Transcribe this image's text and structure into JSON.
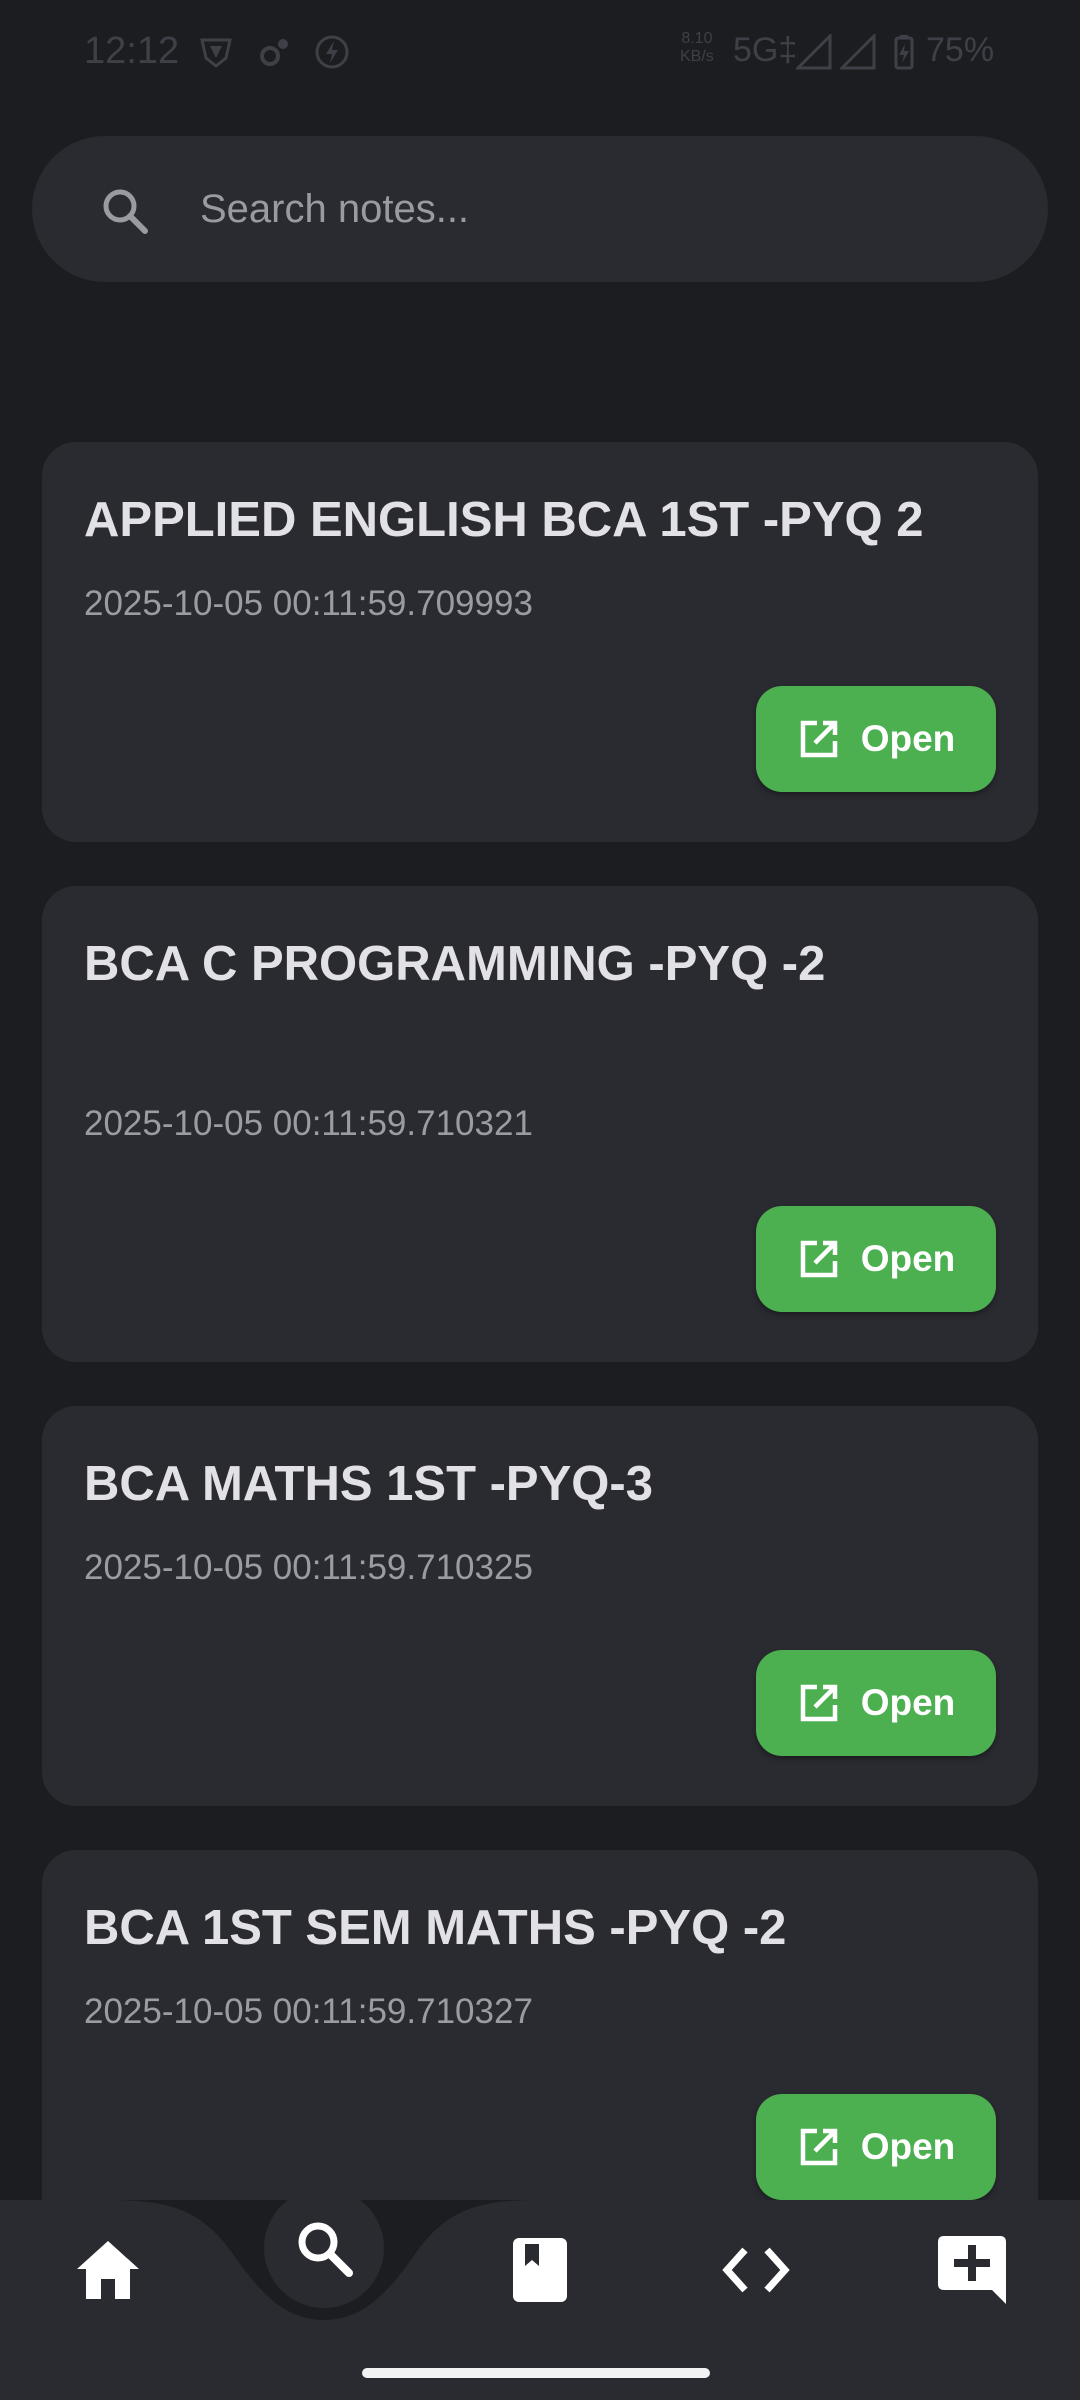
{
  "status_bar": {
    "time": "12:12",
    "speed_value": "8.10",
    "speed_unit": "KB/s",
    "network": "5G‡",
    "battery": "75%"
  },
  "search": {
    "placeholder": "Search notes...",
    "icon": "search-icon"
  },
  "notes": [
    {
      "title": "APPLIED ENGLISH BCA 1ST -PYQ 2",
      "date": "2025-10-05 00:11:59.709993",
      "button_label": "Open"
    },
    {
      "title": "BCA C PROGRAMMING -PYQ -2",
      "date": "2025-10-05 00:11:59.710321",
      "button_label": "Open"
    },
    {
      "title": "BCA MATHS 1ST -PYQ-3",
      "date": "2025-10-05 00:11:59.710325",
      "button_label": "Open"
    },
    {
      "title": "BCA 1ST SEM MATHS -PYQ -2",
      "date": "2025-10-05 00:11:59.710327",
      "button_label": "Open"
    }
  ],
  "bottom_nav": {
    "items": [
      "home-icon",
      "search-icon",
      "book-icon",
      "code-icon",
      "add-note-icon"
    ],
    "active": "search-icon"
  },
  "colors": {
    "background": "#1c1d21",
    "card": "#2a2b31",
    "accent_green": "#4caf50",
    "title_text": "#e2e2e6",
    "secondary_text": "#9b9ca2"
  }
}
